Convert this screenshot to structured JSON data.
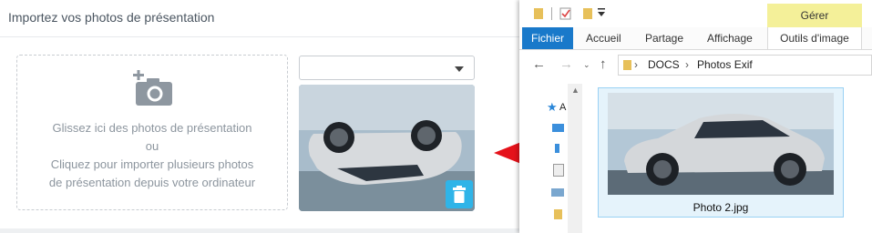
{
  "upload": {
    "title": "Importez vos photos de présentation",
    "dropzone": {
      "line1": "Glissez ici des photos de présentation",
      "line2": "ou",
      "line3": "Cliquez pour importer plusieurs photos",
      "line4": "de présentation depuis votre ordinateur"
    },
    "select": {
      "value": ""
    }
  },
  "explorer": {
    "context_tab": "Gérer",
    "tabs": {
      "file": "Fichier",
      "home": "Accueil",
      "share": "Partage",
      "view": "Affichage",
      "image_tools": "Outils d'image"
    },
    "breadcrumb": [
      "DOCS",
      "Photos Exif"
    ],
    "nav_label_initial": "A",
    "file": {
      "name": "Photo 2.jpg"
    }
  },
  "colors": {
    "accent_blue": "#1979ca",
    "delete_button": "#2fb4e8",
    "arrow": "#e5121a",
    "context_tab": "#f4f099"
  }
}
